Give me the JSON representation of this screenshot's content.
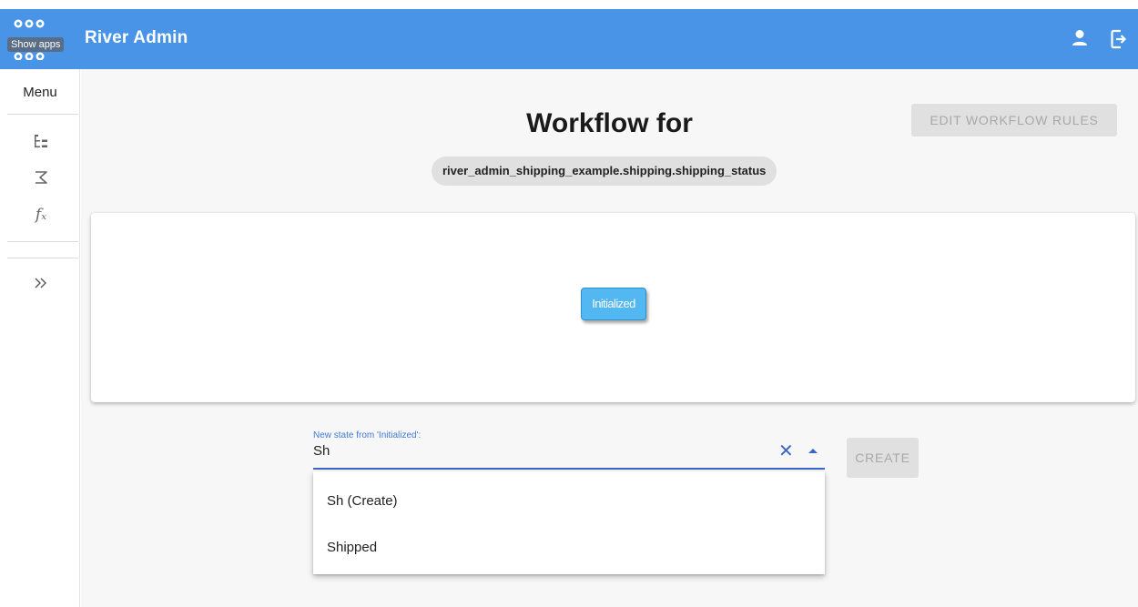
{
  "header": {
    "app_title": "River Admin",
    "apps_tooltip": "Show apps",
    "colors": {
      "topbar": "#4a94e7",
      "accent": "#3a66c9",
      "node": "#53b7f1"
    },
    "icons": [
      "apps-icon",
      "user-icon",
      "logout-icon"
    ]
  },
  "sidebar": {
    "menu_label": "Menu",
    "items": [
      {
        "icon": "tree-icon",
        "glyph": "⊢"
      },
      {
        "icon": "sigma-icon",
        "glyph": "∑"
      },
      {
        "icon": "function-icon",
        "glyph": "fx"
      },
      {
        "icon": "expand-icon",
        "glyph": "»"
      }
    ]
  },
  "main": {
    "title": "Workflow for",
    "workflow_id": "river_admin_shipping_example.shipping.shipping_status",
    "edit_rules_label": "EDIT WORKFLOW RULES",
    "diagram": {
      "states": [
        "Initialized"
      ]
    },
    "new_state": {
      "label": "New state from 'Initialized':",
      "value": "Sh",
      "options": [
        "Sh (Create)",
        "Shipped"
      ]
    },
    "create_label": "CREATE"
  }
}
